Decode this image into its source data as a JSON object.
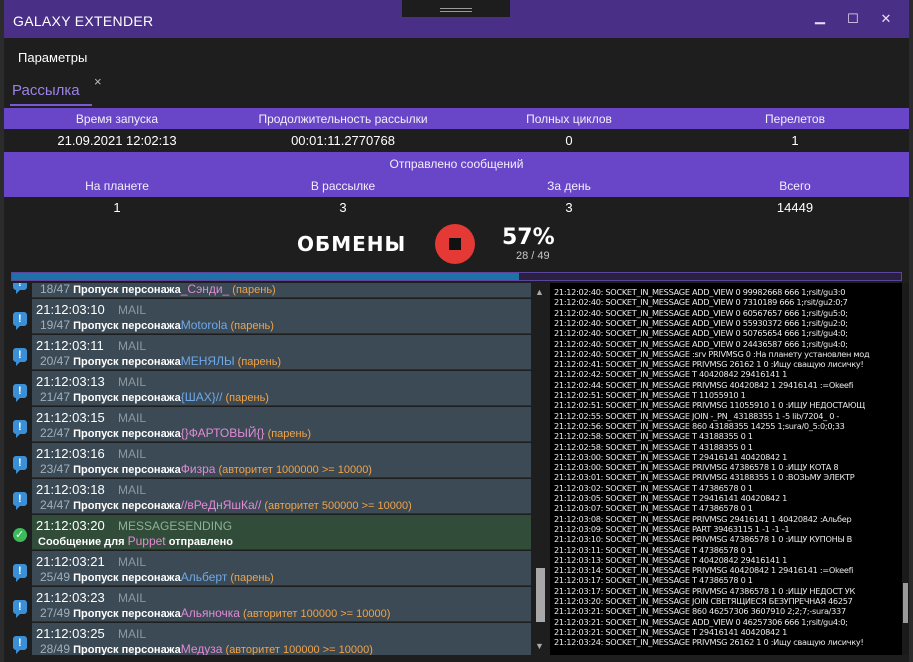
{
  "window": {
    "title": "GALAXY EXTENDER",
    "controls": {
      "minimize": "▁",
      "maximize": "☐",
      "close": "✕"
    }
  },
  "menu": {
    "params": "Параметры"
  },
  "tab": {
    "label": "Рассылка",
    "close": "×"
  },
  "stats_top": {
    "headers": [
      "Время запуска",
      "Продолжительность рассылки",
      "Полных циклов",
      "Перелетов"
    ],
    "values": [
      "21.09.2021 12:02:13",
      "00:01:11.2770768",
      "0",
      "1"
    ]
  },
  "stats_sent": {
    "caption": "Отправлено сообщений",
    "headers": [
      "На планете",
      "В рассылке",
      "За день",
      "Всего"
    ],
    "values": [
      "1",
      "3",
      "3",
      "14449"
    ]
  },
  "control": {
    "label": "ОБМЕНЫ",
    "percent": "57%",
    "progress_text": "28 / 49",
    "progress_fraction": 0.57,
    "stop_color": "#e53935"
  },
  "events": [
    {
      "time": "",
      "kind": "",
      "count": "18/47",
      "text": "Пропуск персонажа",
      "name": "_Сэнди_",
      "reason": "(парень)",
      "name_color": "#e08bd5",
      "partial": true
    },
    {
      "time": "21:12:03:10",
      "kind": "MAIL",
      "count": "19/47",
      "text": "Пропуск персонажа",
      "name": "Motorola",
      "reason": "(парень)",
      "name_color": "#6ea9e8"
    },
    {
      "time": "21:12:03:11",
      "kind": "MAIL",
      "count": "20/47",
      "text": "Пропуск персонажа",
      "name": "МЕНЯЛЫ",
      "reason": "(парень)",
      "name_color": "#6ea9e8"
    },
    {
      "time": "21:12:03:13",
      "kind": "MAIL",
      "count": "21/47",
      "text": "Пропуск персонажа",
      "name": "{ШАХ}//",
      "reason": "(парень)",
      "name_color": "#6ea9e8"
    },
    {
      "time": "21:12:03:15",
      "kind": "MAIL",
      "count": "22/47",
      "text": "Пропуск персонажа",
      "name": "{}ФАРТОВЫЙ{}",
      "reason": "(парень)",
      "name_color": "#e08bd5"
    },
    {
      "time": "21:12:03:16",
      "kind": "MAIL",
      "count": "23/47",
      "text": "Пропуск персонажа",
      "name": "Физра",
      "reason": "(авторитет 1000000 >= 10000)",
      "name_color": "#e08bd5"
    },
    {
      "time": "21:12:03:18",
      "kind": "MAIL",
      "count": "24/47",
      "text": "Пропуск персонажа",
      "name": "//вРеДнЯшКа//",
      "reason": "(авторитет 500000 >= 10000)",
      "name_color": "#e08bd5"
    },
    {
      "time": "21:12:03:20",
      "kind": "MESSAGESENDING",
      "text_before": "Сообщение для",
      "name": "Puppet",
      "text_after": "отправлено",
      "name_color": "#e08bd5",
      "ok": true
    },
    {
      "time": "21:12:03:21",
      "kind": "MAIL",
      "count": "25/49",
      "text": "Пропуск персонажа",
      "name": "Альберт",
      "reason": "(парень)",
      "name_color": "#6ea9e8"
    },
    {
      "time": "21:12:03:23",
      "kind": "MAIL",
      "count": "27/49",
      "text": "Пропуск персонажа",
      "name": "Альяночка",
      "reason": "(авторитет 100000 >= 10000)",
      "name_color": "#e08bd5"
    },
    {
      "time": "21:12:03:25",
      "kind": "MAIL",
      "count": "28/49",
      "text": "Пропуск персонажа",
      "name": "Медуза",
      "reason": "(авторитет 100000 >= 10000)",
      "name_color": "#e08bd5"
    }
  ],
  "log": [
    "21:12:02:40: SOCKET_IN_MESSAGE ADD_VIEW 0 99982668 666 1;rsit/gu3:0",
    "21:12:02:40: SOCKET_IN_MESSAGE ADD_VIEW 0 7310189 666 1;rsit/gu2:0;7",
    "21:12:02:40: SOCKET_IN_MESSAGE ADD_VIEW 0 60567657 666 1;rsit/gu5:0;",
    "21:12:02:40: SOCKET_IN_MESSAGE ADD_VIEW 0 55930372 666 1;rsit/gu2:0;",
    "21:12:02:40: SOCKET_IN_MESSAGE ADD_VIEW 0 50765654 666 1;rsit/gu4:0;",
    "21:12:02:40: SOCKET_IN_MESSAGE ADD_VIEW 0 24436587 666 1;rsit/gu4:0;",
    "21:12:02:40: SOCKET_IN_MESSAGE :srv PRIVMSG 0 :На планету установлен мод",
    "21:12:02:41: SOCKET_IN_MESSAGE PRIVMSG 26162 1 0 :Ищу сващую лисичку!",
    "21:12:02:42: SOCKET_IN_MESSAGE T 40420842 29416141 1",
    "21:12:02:44: SOCKET_IN_MESSAGE PRIVMSG 40420842 1 29416141 :=Okeefi",
    "21:12:02:51: SOCKET_IN_MESSAGE T 11055910 1",
    "21:12:02:51: SOCKET_IN_MESSAGE PRIVMSG 11055910 1 0 :ИЩУ НЕДОСТАЮЩ",
    "21:12:02:55: SOCKET_IN_MESSAGE JOIN -_PN_ 43188355 1 -5 lib/7204_ 0 -",
    "21:12:02:56: SOCKET_IN_MESSAGE 860 43188355 14255 1;sura/0_5:0;0;33",
    "21:12:02:58: SOCKET_IN_MESSAGE T 43188355 0 1",
    "21:12:02:58: SOCKET_IN_MESSAGE T 43188355 0 1",
    "21:12:03:00: SOCKET_IN_MESSAGE T 29416141 40420842 1",
    "21:12:03:00: SOCKET_IN_MESSAGE PRIVMSG 47386578 1 0 :ИЩУ КОТА 8",
    "21:12:03:01: SOCKET_IN_MESSAGE PRIVMSG 43188355 1 0 :ВОЗЬМУ ЭЛЕКТР",
    "21:12:03:02: SOCKET_IN_MESSAGE T 47386578 0 1",
    "21:12:03:05: SOCKET_IN_MESSAGE T 29416141 40420842 1",
    "21:12:03:07: SOCKET_IN_MESSAGE T 47386578 0 1",
    "21:12:03:08: SOCKET_IN_MESSAGE PRIVMSG 29416141 1 40420842 :Альбер",
    "21:12:03:09: SOCKET_IN_MESSAGE PART 39463115 1 -1 -1 -1",
    "21:12:03:10: SOCKET_IN_MESSAGE PRIVMSG 47386578 1 0 :ИЩУ КУПОНЫ В",
    "21:12:03:11: SOCKET_IN_MESSAGE T 47386578 0 1",
    "21:12:03:13: SOCKET_IN_MESSAGE T 40420842 29416141 1",
    "21:12:03:14: SOCKET_IN_MESSAGE PRIVMSG 40420842 1 29416141 :=Okeefi",
    "21:12:03:17: SOCKET_IN_MESSAGE T 47386578 0 1",
    "21:12:03:17: SOCKET_IN_MESSAGE PRIVMSG 47386578 1 0 :ИЩУ НЕДОСТ УК",
    "21:12:03:20: SOCKET_IN_MESSAGE JOIN СВЕТЯЩИЕСЯ БЕЗУПРЕЧНАЯ 46257",
    "21:12:03:21: SOCKET_IN_MESSAGE 860 46257306 3607910 2;2;7;-sura/337",
    "21:12:03:21: SOCKET_IN_MESSAGE ADD_VIEW 0 46257306 666 1;rsit/gu4:0;",
    "21:12:03:21: SOCKET_IN_MESSAGE T 29416141 40420842 1",
    "21:12:03:24: SOCKET_IN_MESSAGE PRIVMSG 26162 1 0 :Ищу сващую лисичку!"
  ]
}
